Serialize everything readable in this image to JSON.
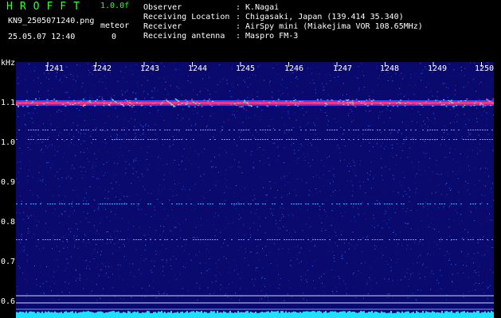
{
  "header": {
    "logo": "HROFFT",
    "version": "1.0.0f",
    "filename": "KN9_2505071240.png",
    "datetime": "25.05.07 12:40",
    "meteor_label": "meteor",
    "meteor_count": "0",
    "fields": [
      {
        "label": "Observer",
        "value": ": K.Nagai"
      },
      {
        "label": "Receiving Location",
        "value": ": Chigasaki, Japan (139.414 35.340)"
      },
      {
        "label": "Receiver",
        "value": ": AirSpy mini (Miakejima VOR 108.65MHz)"
      },
      {
        "label": "Receiving antenna",
        "value": ": Maspro FM-3"
      }
    ]
  },
  "axis": {
    "y_unit": "kHz",
    "y_ticks": [
      "1.1",
      "1.0",
      "0.9",
      "0.8",
      "0.7",
      "0.6"
    ],
    "x_ticks": [
      "1241",
      "1242",
      "1243",
      "1244",
      "1245",
      "1246",
      "1247",
      "1248",
      "1249",
      "1250"
    ]
  },
  "colors": {
    "background": "#0a0a6e",
    "carrier": "#ff3080",
    "noise_floor": "#1ee0ff"
  }
}
